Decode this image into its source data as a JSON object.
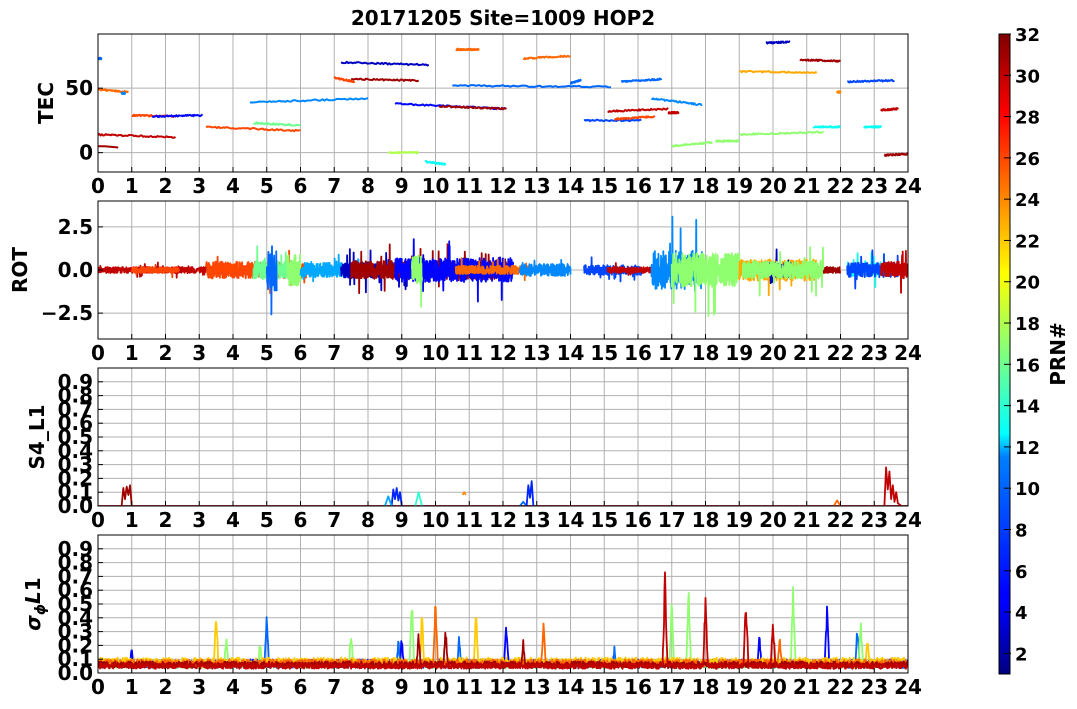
{
  "title": "20171205 Site=1009 HOP2",
  "colorbar": {
    "label": "PRN#",
    "ticks": [
      "2",
      "4",
      "6",
      "8",
      "10",
      "12",
      "14",
      "16",
      "18",
      "20",
      "22",
      "24",
      "26",
      "28",
      "30",
      "32"
    ],
    "range": [
      1,
      32
    ],
    "colormap": "jet"
  },
  "chart_data": [
    {
      "type": "line",
      "ylabel": "TEC",
      "xlim": [
        0,
        24
      ],
      "ylim": [
        -15,
        92
      ],
      "xticks": [
        "0",
        "1",
        "2",
        "3",
        "4",
        "5",
        "6",
        "7",
        "8",
        "9",
        "10",
        "11",
        "12",
        "13",
        "14",
        "15",
        "16",
        "17",
        "18",
        "19",
        "20",
        "21",
        "22",
        "23",
        "24"
      ],
      "yticks": [
        {
          "v": 0,
          "label": "0"
        },
        {
          "v": 50,
          "label": "50"
        }
      ],
      "grid": true,
      "series": [
        {
          "prn": 8,
          "x": [
            0.0,
            0.1
          ],
          "y": [
            73,
            73
          ]
        },
        {
          "prn": 25,
          "x": [
            0.0,
            0.9
          ],
          "y": [
            49,
            47
          ]
        },
        {
          "prn": 30,
          "x": [
            0.0,
            2.3
          ],
          "y": [
            14,
            12
          ]
        },
        {
          "prn": 31,
          "x": [
            0.0,
            0.2,
            0.6
          ],
          "y": [
            5,
            5,
            4
          ]
        },
        {
          "prn": 9,
          "x": [
            0.7,
            0.8
          ],
          "y": [
            46,
            46
          ]
        },
        {
          "prn": 26,
          "x": [
            1.0,
            2.3
          ],
          "y": [
            29,
            28
          ]
        },
        {
          "prn": 5,
          "x": [
            1.6,
            3.1
          ],
          "y": [
            28,
            29
          ]
        },
        {
          "prn": 26,
          "x": [
            3.2,
            6.0
          ],
          "y": [
            20,
            17
          ]
        },
        {
          "prn": 16,
          "x": [
            4.6,
            6.0
          ],
          "y": [
            23,
            21
          ]
        },
        {
          "prn": 9,
          "x": [
            4.5,
            8.0
          ],
          "y": [
            39,
            42
          ]
        },
        {
          "prn": 26,
          "x": [
            7.0,
            7.6
          ],
          "y": [
            58,
            55
          ]
        },
        {
          "prn": 3,
          "x": [
            7.2,
            9.8
          ],
          "y": [
            70,
            68
          ]
        },
        {
          "prn": 31,
          "x": [
            7.5,
            9.5
          ],
          "y": [
            57,
            56
          ]
        },
        {
          "prn": 5,
          "x": [
            8.8,
            12.1
          ],
          "y": [
            38,
            34
          ]
        },
        {
          "prn": 31,
          "x": [
            10.1,
            12.1
          ],
          "y": [
            36,
            34
          ]
        },
        {
          "prn": 18,
          "x": [
            8.6,
            9.5
          ],
          "y": [
            0,
            0
          ]
        },
        {
          "prn": 13,
          "x": [
            9.7,
            10.3
          ],
          "y": [
            -7,
            -9
          ]
        },
        {
          "prn": 25,
          "x": [
            10.6,
            11.3
          ],
          "y": [
            80,
            80
          ]
        },
        {
          "prn": 8,
          "x": [
            10.5,
            15.2
          ],
          "y": [
            52,
            51
          ]
        },
        {
          "prn": 25,
          "x": [
            12.6,
            14.0
          ],
          "y": [
            73,
            75
          ]
        },
        {
          "prn": 8,
          "x": [
            14.0,
            14.3
          ],
          "y": [
            54,
            56
          ]
        },
        {
          "prn": 7,
          "x": [
            14.4,
            16.1
          ],
          "y": [
            25,
            25
          ]
        },
        {
          "prn": 30,
          "x": [
            15.1,
            16.9
          ],
          "y": [
            32,
            34
          ]
        },
        {
          "prn": 26,
          "x": [
            15.3,
            16.5
          ],
          "y": [
            26,
            28
          ]
        },
        {
          "prn": 8,
          "x": [
            15.5,
            16.7
          ],
          "y": [
            55,
            57
          ]
        },
        {
          "prn": 9,
          "x": [
            16.4,
            17.9
          ],
          "y": [
            42,
            37
          ]
        },
        {
          "prn": 30,
          "x": [
            16.9,
            17.2
          ],
          "y": [
            31,
            31
          ]
        },
        {
          "prn": 17,
          "x": [
            17.0,
            18.2
          ],
          "y": [
            5,
            8
          ]
        },
        {
          "prn": 17,
          "x": [
            18.3,
            19.0
          ],
          "y": [
            9,
            9
          ]
        },
        {
          "prn": 23,
          "x": [
            19.0,
            21.3
          ],
          "y": [
            63,
            62
          ]
        },
        {
          "prn": 3,
          "x": [
            19.8,
            20.5
          ],
          "y": [
            85,
            86
          ]
        },
        {
          "prn": 31,
          "x": [
            20.8,
            22.0
          ],
          "y": [
            72,
            71
          ]
        },
        {
          "prn": 17,
          "x": [
            19.0,
            21.5
          ],
          "y": [
            14,
            16
          ]
        },
        {
          "prn": 13,
          "x": [
            21.2,
            22.0
          ],
          "y": [
            20,
            20
          ]
        },
        {
          "prn": 24,
          "x": [
            21.9,
            22.0
          ],
          "y": [
            47,
            47
          ]
        },
        {
          "prn": 7,
          "x": [
            22.2,
            23.6
          ],
          "y": [
            55,
            56
          ]
        },
        {
          "prn": 13,
          "x": [
            22.7,
            23.2
          ],
          "y": [
            20,
            20
          ]
        },
        {
          "prn": 30,
          "x": [
            23.2,
            23.7
          ],
          "y": [
            33,
            34
          ]
        },
        {
          "prn": 31,
          "x": [
            23.3,
            24.0
          ],
          "y": [
            -2,
            -1
          ]
        }
      ]
    },
    {
      "type": "line",
      "ylabel": "ROT",
      "xlim": [
        0,
        24
      ],
      "ylim": [
        -4,
        4
      ],
      "xticks": [
        "0",
        "1",
        "2",
        "3",
        "4",
        "5",
        "6",
        "7",
        "8",
        "9",
        "10",
        "11",
        "12",
        "13",
        "14",
        "15",
        "16",
        "17",
        "18",
        "19",
        "20",
        "21",
        "22",
        "23",
        "24"
      ],
      "yticks": [
        {
          "v": -2.5,
          "label": "−2.5"
        },
        {
          "v": 0,
          "label": "0.0"
        },
        {
          "v": 2.5,
          "label": "2.5"
        }
      ],
      "grid": true,
      "series": [
        {
          "prn": 30,
          "x": [
            0.0,
            3.2
          ],
          "amp": 0.5
        },
        {
          "prn": 26,
          "x": [
            1.0,
            2.4
          ],
          "amp": 0.5
        },
        {
          "prn": 26,
          "x": [
            3.2,
            6.2
          ],
          "amp": 1.4
        },
        {
          "prn": 16,
          "x": [
            4.6,
            6.0
          ],
          "amp": 1.5
        },
        {
          "prn": 8,
          "x": [
            5.0,
            5.3
          ],
          "amp": 3.5
        },
        {
          "prn": 17,
          "x": [
            5.6,
            6.0
          ],
          "amp": 2.6
        },
        {
          "prn": 10,
          "x": [
            6.0,
            8.0
          ],
          "amp": 1.2
        },
        {
          "prn": 3,
          "x": [
            7.2,
            9.8
          ],
          "amp": 1.3
        },
        {
          "prn": 31,
          "x": [
            7.5,
            12.1
          ],
          "amp": 1.5
        },
        {
          "prn": 5,
          "x": [
            8.8,
            12.3
          ],
          "amp": 2.0
        },
        {
          "prn": 17,
          "x": [
            9.3,
            9.6
          ],
          "amp": 2.5
        },
        {
          "prn": 25,
          "x": [
            10.6,
            12.8
          ],
          "amp": 0.7
        },
        {
          "prn": 9,
          "x": [
            12.5,
            14.0
          ],
          "amp": 1.0
        },
        {
          "prn": 7,
          "x": [
            14.4,
            16.1
          ],
          "amp": 0.8
        },
        {
          "prn": 30,
          "x": [
            15.1,
            17.0
          ],
          "amp": 0.5
        },
        {
          "prn": 9,
          "x": [
            16.4,
            17.9
          ],
          "amp": 3.2
        },
        {
          "prn": 17,
          "x": [
            17.0,
            19.0
          ],
          "amp": 2.8
        },
        {
          "prn": 23,
          "x": [
            19.0,
            21.3
          ],
          "amp": 1.8
        },
        {
          "prn": 3,
          "x": [
            19.8,
            20.6
          ],
          "amp": 1.2
        },
        {
          "prn": 31,
          "x": [
            20.6,
            22.0
          ],
          "amp": 0.5
        },
        {
          "prn": 17,
          "x": [
            19.1,
            21.5
          ],
          "amp": 1.5
        },
        {
          "prn": 13,
          "x": [
            22.2,
            23.2
          ],
          "amp": 1.0
        },
        {
          "prn": 7,
          "x": [
            22.2,
            23.7
          ],
          "amp": 1.2
        },
        {
          "prn": 30,
          "x": [
            23.2,
            24.0
          ],
          "amp": 1.4
        }
      ]
    },
    {
      "type": "line",
      "ylabel": "S4_L1",
      "xlim": [
        0,
        24
      ],
      "ylim": [
        0,
        1
      ],
      "xticks": [
        "0",
        "1",
        "2",
        "3",
        "4",
        "5",
        "6",
        "7",
        "8",
        "9",
        "10",
        "11",
        "12",
        "13",
        "14",
        "15",
        "16",
        "17",
        "18",
        "19",
        "20",
        "21",
        "22",
        "23",
        "24"
      ],
      "yticks": [
        {
          "v": 0,
          "label": "0.0"
        },
        {
          "v": 0.1,
          "label": "0.1"
        },
        {
          "v": 0.2,
          "label": "0.2"
        },
        {
          "v": 0.3,
          "label": "0.3"
        },
        {
          "v": 0.4,
          "label": "0.4"
        },
        {
          "v": 0.5,
          "label": "0.5"
        },
        {
          "v": 0.6,
          "label": "0.6"
        },
        {
          "v": 0.7,
          "label": "0.7"
        },
        {
          "v": 0.8,
          "label": "0.8"
        },
        {
          "v": 0.9,
          "label": "0.9"
        }
      ],
      "grid": true,
      "series": [
        {
          "prn": 31,
          "x": [
            0.0,
            24.0
          ],
          "y": [
            0.0,
            0.0
          ]
        },
        {
          "prn": 31,
          "x": [
            0.7,
            0.75,
            0.8,
            0.85,
            0.9,
            0.95,
            1.0
          ],
          "y": [
            0.0,
            0.13,
            0.05,
            0.14,
            0.08,
            0.15,
            0.0
          ]
        },
        {
          "prn": 6,
          "x": [
            8.7,
            8.75,
            8.8,
            8.85,
            8.9,
            8.95,
            9.0
          ],
          "y": [
            0.0,
            0.12,
            0.05,
            0.13,
            0.04,
            0.1,
            0.0
          ]
        },
        {
          "prn": 10,
          "x": [
            8.5,
            8.6,
            8.7
          ],
          "y": [
            0.0,
            0.07,
            0.0
          ]
        },
        {
          "prn": 14,
          "x": [
            9.4,
            9.5,
            9.6
          ],
          "y": [
            0.0,
            0.1,
            0.0
          ]
        },
        {
          "prn": 24,
          "x": [
            10.8,
            10.85,
            10.9
          ],
          "y": [
            0.08,
            0.1,
            0.08
          ]
        },
        {
          "prn": 8,
          "x": [
            12.5,
            12.6,
            12.7
          ],
          "y": [
            0.0,
            0.03,
            0.0
          ]
        },
        {
          "prn": 6,
          "x": [
            12.7,
            12.75,
            12.8,
            12.85,
            12.9
          ],
          "y": [
            0.0,
            0.15,
            0.06,
            0.18,
            0.0
          ]
        },
        {
          "prn": 25,
          "x": [
            21.8,
            21.9,
            22.0
          ],
          "y": [
            0.0,
            0.04,
            0.0
          ]
        },
        {
          "prn": 30,
          "x": [
            23.3,
            23.35,
            23.4,
            23.45,
            23.5,
            23.55,
            23.6,
            23.65,
            23.7,
            23.8
          ],
          "y": [
            0.0,
            0.28,
            0.12,
            0.25,
            0.05,
            0.15,
            0.03,
            0.1,
            0.02,
            0.0
          ]
        }
      ]
    },
    {
      "type": "line",
      "ylabel": "σ_φ L1",
      "xlim": [
        0,
        24
      ],
      "ylim": [
        0,
        1
      ],
      "xticks": [
        "0",
        "1",
        "2",
        "3",
        "4",
        "5",
        "6",
        "7",
        "8",
        "9",
        "10",
        "11",
        "12",
        "13",
        "14",
        "15",
        "16",
        "17",
        "18",
        "19",
        "20",
        "21",
        "22",
        "23",
        "24"
      ],
      "yticks": [
        {
          "v": 0,
          "label": "0.0"
        },
        {
          "v": 0.1,
          "label": "0.1"
        },
        {
          "v": 0.2,
          "label": "0.2"
        },
        {
          "v": 0.3,
          "label": "0.3"
        },
        {
          "v": 0.4,
          "label": "0.4"
        },
        {
          "v": 0.5,
          "label": "0.5"
        },
        {
          "v": 0.6,
          "label": "0.6"
        },
        {
          "v": 0.7,
          "label": "0.7"
        },
        {
          "v": 0.8,
          "label": "0.8"
        },
        {
          "v": 0.9,
          "label": "0.9"
        }
      ],
      "grid": true,
      "series": [
        {
          "prn": 5,
          "x": [
            0.0,
            24.0
          ],
          "base": 0.07,
          "peaks": [
            [
              1.0,
              0.2
            ],
            [
              9.0,
              0.3
            ],
            [
              12.1,
              0.4
            ],
            [
              19.6,
              0.3
            ],
            [
              21.6,
              0.5
            ],
            [
              23.5,
              0.12
            ]
          ]
        },
        {
          "prn": 8,
          "x": [
            0.0,
            24.0
          ],
          "base": 0.06,
          "peaks": [
            [
              5.0,
              0.44
            ],
            [
              8.9,
              0.25
            ],
            [
              10.7,
              0.28
            ],
            [
              15.3,
              0.2
            ],
            [
              22.5,
              0.38
            ]
          ]
        },
        {
          "prn": 17,
          "x": [
            0.0,
            24.0
          ],
          "base": 0.06,
          "peaks": [
            [
              3.8,
              0.3
            ],
            [
              4.8,
              0.25
            ],
            [
              7.5,
              0.35
            ],
            [
              9.3,
              0.57
            ],
            [
              17.0,
              0.55
            ],
            [
              17.5,
              0.63
            ],
            [
              20.6,
              0.7
            ],
            [
              22.6,
              0.4
            ]
          ]
        },
        {
          "prn": 22,
          "x": [
            0.0,
            24.0
          ],
          "base": 0.08,
          "peaks": [
            [
              3.5,
              0.53
            ],
            [
              9.6,
              0.48
            ],
            [
              11.2,
              0.48
            ],
            [
              22.8,
              0.28
            ]
          ]
        },
        {
          "prn": 25,
          "x": [
            0.0,
            24.0
          ],
          "base": 0.07,
          "peaks": [
            [
              10.0,
              0.55
            ],
            [
              13.2,
              0.45
            ],
            [
              20.2,
              0.3
            ]
          ]
        },
        {
          "prn": 31,
          "x": [
            0.0,
            24.0
          ],
          "base": 0.06,
          "peaks": [
            [
              9.5,
              0.3
            ],
            [
              10.3,
              0.35
            ],
            [
              12.6,
              0.25
            ]
          ]
        },
        {
          "prn": 30,
          "x": [
            0.0,
            24.0
          ],
          "base": 0.05,
          "peaks": [
            [
              16.8,
              0.77
            ],
            [
              18.0,
              0.58
            ],
            [
              19.2,
              0.62
            ],
            [
              20.0,
              0.45
            ]
          ]
        }
      ]
    }
  ]
}
